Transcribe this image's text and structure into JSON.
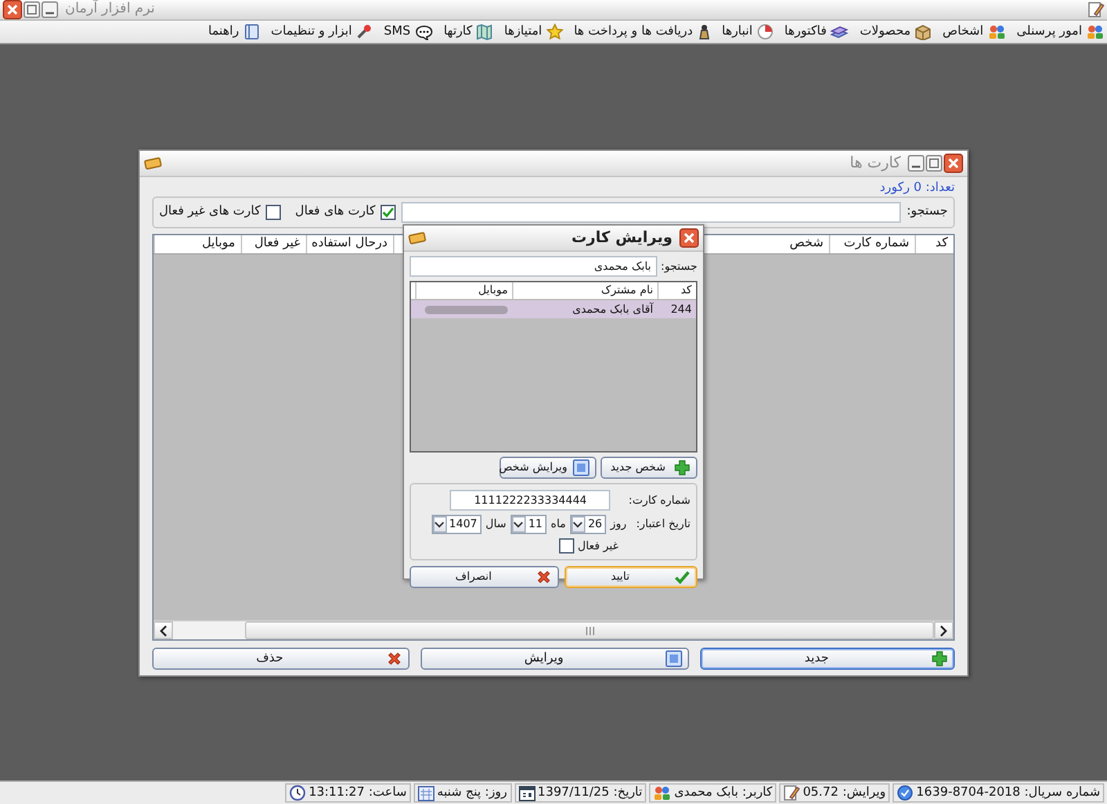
{
  "app_window": {
    "title": "نرم افزار آرمان"
  },
  "menu": [
    {
      "label": "امور پرسنلی"
    },
    {
      "label": "اشخاص"
    },
    {
      "label": "محصولات"
    },
    {
      "label": "فاکتورها"
    },
    {
      "label": "انبارها"
    },
    {
      "label": "دریافت ها و پرداخت ها"
    },
    {
      "label": "امتیازها"
    },
    {
      "label": "کارتها"
    },
    {
      "label": "SMS"
    },
    {
      "label": "ابزار و تنظیمات"
    },
    {
      "label": "راهنما"
    }
  ],
  "cards_window": {
    "title": "کارت ها",
    "count": "تعداد: 0 رکورد",
    "search_label": "جستجو:",
    "filters": [
      {
        "label": "کارت های فعال",
        "checked": true
      },
      {
        "label": "کارت های غیر فعال",
        "checked": false
      }
    ],
    "columns": [
      {
        "label": "کد"
      },
      {
        "label": "شماره کارت"
      },
      {
        "label": "شخص"
      },
      {},
      {},
      {
        "label": "درحال استفاده"
      },
      {
        "label": "غیر فعال"
      },
      {
        "label": "موبایل"
      }
    ],
    "buttons": [
      {
        "label": "جدید",
        "kind": "add",
        "focused": true
      },
      {
        "label": "ویرایش",
        "kind": "edit",
        "focused": false
      },
      {
        "label": "حذف",
        "kind": "delete",
        "focused": false
      }
    ]
  },
  "dialog": {
    "title": "ویرایش کارت",
    "search_label": "جستجو:",
    "search_value": "بابک محمدی",
    "columns": [
      {
        "label": "کد"
      },
      {
        "label": "نام مشترک"
      },
      {
        "label": "موبایل"
      }
    ],
    "rows": [
      {
        "code": "244",
        "name": "آقای بابک محمدی",
        "selected": true
      }
    ],
    "person_buttons": [
      {
        "label": "شخص جدید",
        "kind": "add"
      },
      {
        "label": "ویرایش شخص",
        "kind": "edit"
      }
    ],
    "card_number_label": "شماره کارت:",
    "card_number": "1111222233334444",
    "expiry_label": "تاریخ اعتبار:",
    "expiry": [
      {
        "label": "روز",
        "value": "26"
      },
      {
        "label": "ماه",
        "value": "11"
      },
      {
        "label": "سال",
        "value": "1407"
      }
    ],
    "inactive": {
      "label": "غیر فعال",
      "checked": false
    },
    "buttons": [
      {
        "label": "تایید",
        "kind": "ok",
        "focused": true
      },
      {
        "label": "انصراف",
        "kind": "delete",
        "focused": false
      }
    ]
  },
  "status_bar": [
    {
      "text": "شماره سریال: 2018-8704-1639"
    },
    {
      "text": "ویرایش: 05.72"
    },
    {
      "text": "کاربر: بابک محمدی"
    },
    {
      "text": "تاریخ: 1397/11/25"
    },
    {
      "text": "روز: پنج شنبه"
    },
    {
      "text": "ساعت: 13:11:27"
    }
  ]
}
